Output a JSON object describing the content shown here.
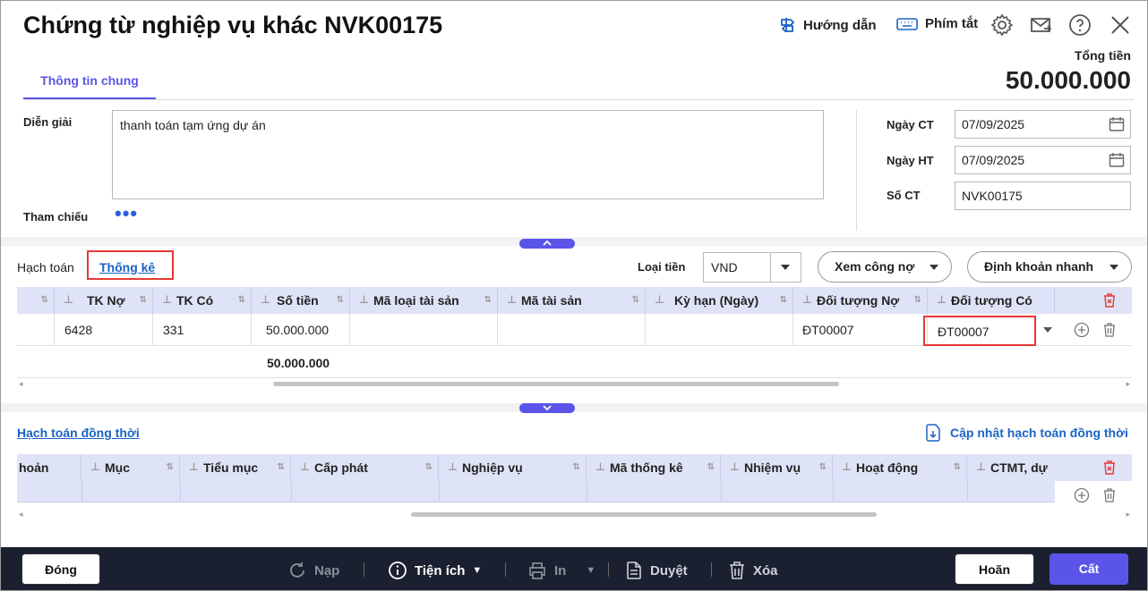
{
  "header": {
    "title": "Chứng từ nghiệp vụ khác NVK00175",
    "guide_label": "Hướng dẫn",
    "shortcut_label": "Phím tắt",
    "total_label": "Tổng tiền",
    "total_value": "50.000.000"
  },
  "tabs": {
    "general": "Thông tin chung"
  },
  "form": {
    "description_label": "Diễn giải",
    "description_value": "thanh toán tạm ứng dự án",
    "reference_label": "Tham chiếu",
    "reference_dots": "•••",
    "date_ct_label": "Ngày CT",
    "date_ct_value": "07/09/2025",
    "date_ht_label": "Ngày HT",
    "date_ht_value": "07/09/2025",
    "so_ct_label": "Số CT",
    "so_ct_value": "NVK00175"
  },
  "grid_toolbar": {
    "tab_hach_toan": "Hạch toán",
    "tab_thong_ke": "Thống kê",
    "currency_label": "Loại tiền",
    "currency_value": "VND",
    "debt_button": "Xem công nợ",
    "quick_entry_button": "Định khoản nhanh"
  },
  "main_grid": {
    "columns": [
      "TK Nợ",
      "TK Có",
      "Số tiền",
      "Mã loại tài sản",
      "Mã tài sản",
      "Kỳ hạn (Ngày)",
      "Đối tượng Nợ",
      "Đối tượng Có"
    ],
    "row": {
      "tk_no": "6428",
      "tk_co": "331",
      "so_tien": "50.000.000",
      "ma_loai_ts": "",
      "ma_ts": "",
      "ky_han": "",
      "doi_tuong_no": "ĐT00007",
      "doi_tuong_co": "ĐT00007"
    },
    "total": "50.000.000"
  },
  "concurrent": {
    "link": "Hạch toán đồng thời",
    "update_link": "Cập nhật hạch toán đồng thời",
    "columns": [
      "hoản",
      "Mục",
      "Tiểu mục",
      "Cấp phát",
      "Nghiệp vụ",
      "Mã thống kê",
      "Nhiệm vụ",
      "Hoạt động",
      "CTMT, dự"
    ]
  },
  "footer": {
    "close": "Đóng",
    "reload": "Nạp",
    "utilities": "Tiện ích",
    "print": "In",
    "approve": "Duyệt",
    "delete": "Xóa",
    "cancel": "Hoãn",
    "save": "Cất"
  },
  "colors": {
    "accent": "#5a55e8",
    "link": "#1b63c6",
    "highlight": "#e53935",
    "footer_bg": "#1b2030"
  }
}
